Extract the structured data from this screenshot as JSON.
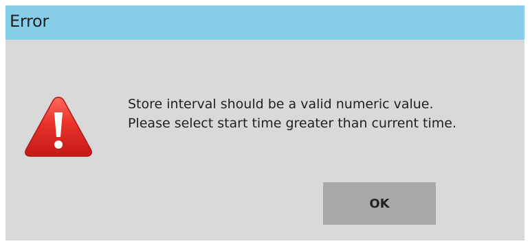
{
  "window": {
    "title": "Error"
  },
  "dialog": {
    "icon": "warning-icon",
    "message_lines": [
      "Store interval should be a valid numeric value.",
      "Please select start time greater than current time."
    ],
    "ok_label": "OK"
  },
  "colors": {
    "title_bar": "#87ceeb",
    "dialog_bg": "#d9d9d9",
    "button_bg": "#a8a8a8",
    "icon_red": "#e32b2b"
  }
}
